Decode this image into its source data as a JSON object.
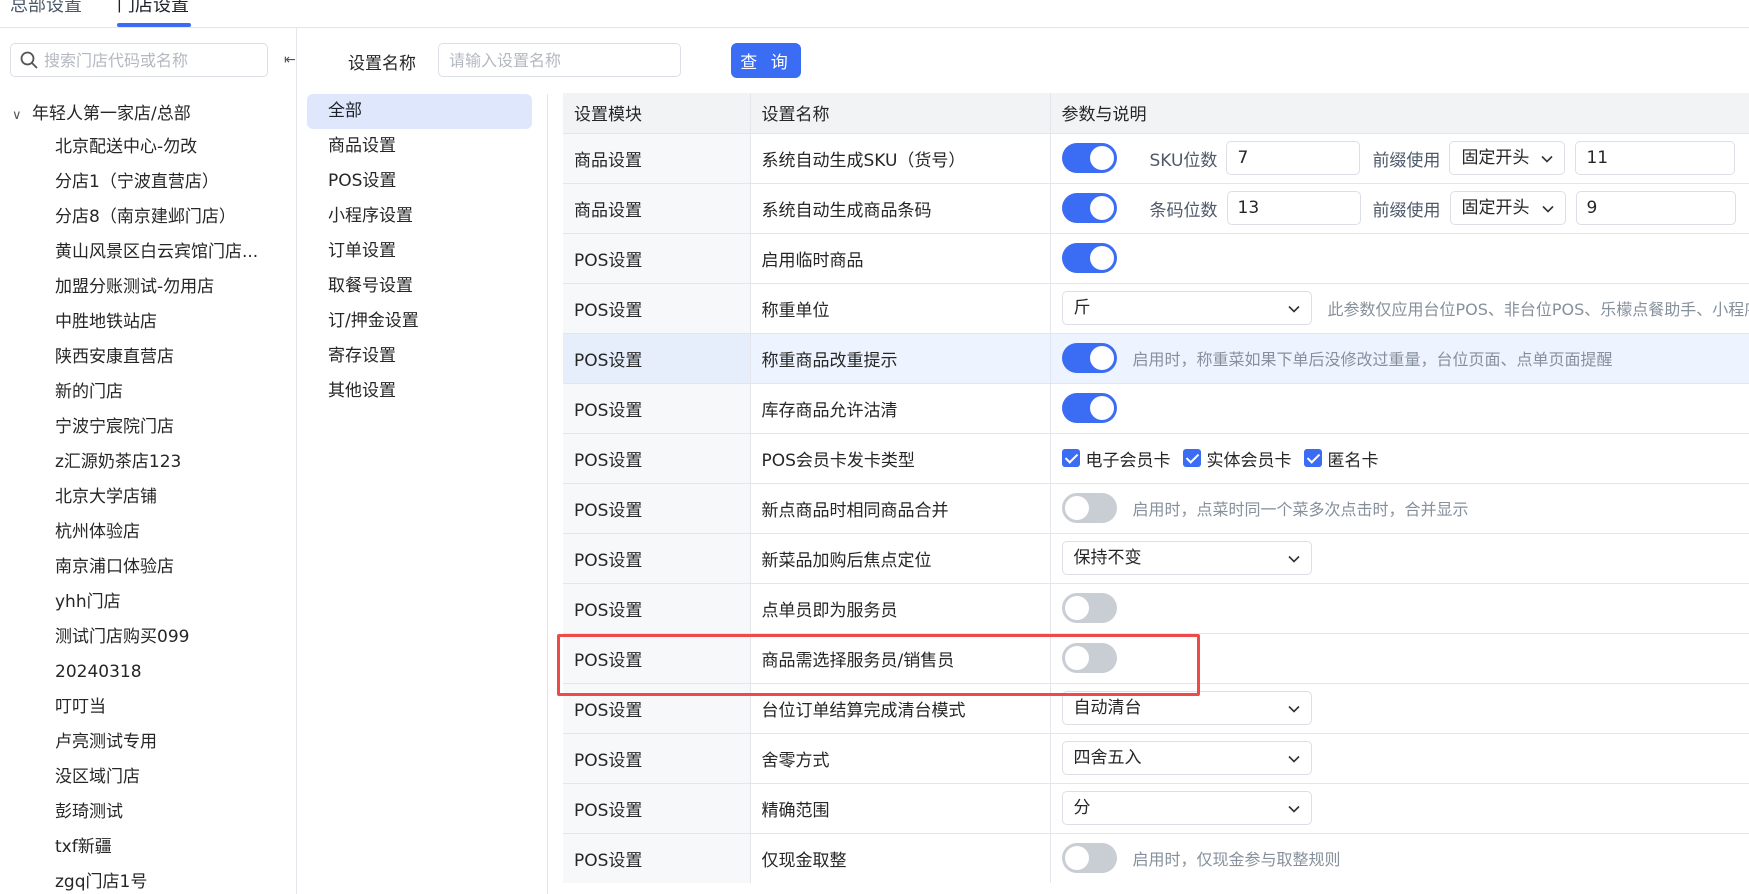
{
  "top_tabs": [
    {
      "label": "总部设置"
    },
    {
      "label": "门店设置"
    }
  ],
  "store_search": {
    "placeholder": "搜索门店代码或名称"
  },
  "tree": {
    "root": "年轻人第一家店/总部",
    "stores": [
      "北京配送中心-勿改",
      "分店1（宁波直营店）",
      "分店8（南京建邺门店）",
      "黄山风景区白云宾馆门店...",
      "加盟分账测试-勿用店",
      "中胜地铁站店",
      "陕西安康直营店",
      "新的门店",
      "宁波宁宸院门店",
      "z汇源奶茶店123",
      "北京大学店铺",
      "杭州体验店",
      "南京浦口体验店",
      "yhh门店",
      "测试门店购买099",
      "20240318",
      "叮叮当",
      "卢亮测试专用",
      "没区域门店",
      "彭琦测试",
      "txf新疆",
      "zgq门店1号"
    ]
  },
  "filter": {
    "label": "设置名称",
    "placeholder": "请输入设置名称",
    "button": "查 询"
  },
  "categories": [
    "全部",
    "商品设置",
    "POS设置",
    "小程序设置",
    "订单设置",
    "取餐号设置",
    "订/押金设置",
    "寄存设置",
    "其他设置"
  ],
  "table": {
    "headers": [
      "设置模块",
      "设置名称",
      "参数与说明"
    ],
    "rows": [
      {
        "module": "商品设置",
        "name": "系统自动生成SKU（货号）",
        "switch_on": true,
        "digits_label": "SKU位数",
        "digits": "7",
        "prefix_label": "前缀使用",
        "prefix_mode": "固定开头",
        "prefix_value": "11"
      },
      {
        "module": "商品设置",
        "name": "系统自动生成商品条码",
        "switch_on": true,
        "digits_label": "条码位数",
        "digits": "13",
        "prefix_label": "前缀使用",
        "prefix_mode": "固定开头",
        "prefix_value": "9"
      },
      {
        "module": "POS设置",
        "name": "启用临时商品",
        "switch_on": true
      },
      {
        "module": "POS设置",
        "name": "称重单位",
        "select": "斤",
        "desc": "此参数仅应用台位POS、非台位POS、乐檬点餐助手、小程序"
      },
      {
        "module": "POS设置",
        "name": "称重商品改重提示",
        "switch_on": true,
        "desc": "启用时，称重菜如果下单后没修改过重量，台位页面、点单页面提醒"
      },
      {
        "module": "POS设置",
        "name": "库存商品允许沽清",
        "switch_on": true
      },
      {
        "module": "POS设置",
        "name": "POS会员卡发卡类型",
        "checks": [
          "电子会员卡",
          "实体会员卡",
          "匿名卡"
        ]
      },
      {
        "module": "POS设置",
        "name": "新点商品时相同商品合并",
        "switch_on": false,
        "desc": "启用时，点菜时同一个菜多次点击时，合并显示"
      },
      {
        "module": "POS设置",
        "name": "新菜品加购后焦点定位",
        "select": "保持不变"
      },
      {
        "module": "POS设置",
        "name": "点单员即为服务员",
        "switch_on": false
      },
      {
        "module": "POS设置",
        "name": "商品需选择服务员/销售员",
        "switch_on": false
      },
      {
        "module": "POS设置",
        "name": "台位订单结算完成清台模式",
        "select": "自动清台"
      },
      {
        "module": "POS设置",
        "name": "舍零方式",
        "select": "四舍五入"
      },
      {
        "module": "POS设置",
        "name": "精确范围",
        "select": "分"
      },
      {
        "module": "POS设置",
        "name": "仅现金取整",
        "switch_on": false,
        "desc": "启用时，仅现金参与取整规则"
      }
    ]
  },
  "colors": {
    "accent": "#3a6cf4",
    "highlight": "#ee4a4a"
  }
}
